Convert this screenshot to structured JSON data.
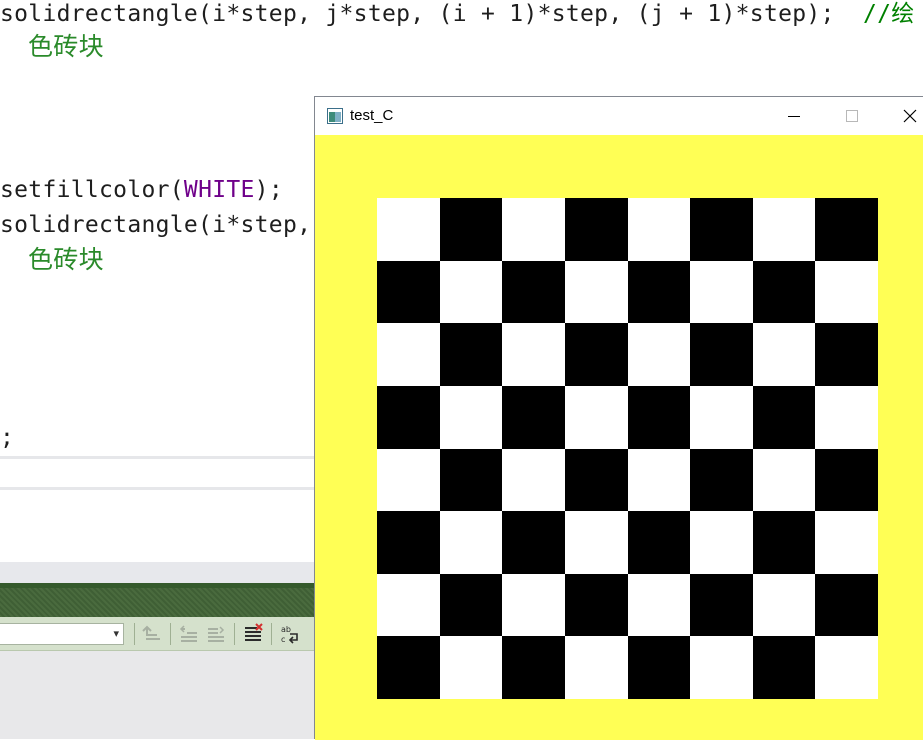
{
  "editor": {
    "line1_code": "solidrectangle(i*step, j*step, (i + 1)*step, (j + 1)*step);",
    "line1_comment": "//绘",
    "line1_cont": "色砖块",
    "line2_func": "setfillcolor(",
    "line2_macro": "WHITE",
    "line2_end": ");",
    "line3_code": "solidrectangle(i*step,",
    "line3_cont": "色砖块",
    "line4_code": ";"
  },
  "output_panel": {
    "dropdown_value": "",
    "tools": [
      "goto-previous-icon",
      "find-previous-icon",
      "find-next-icon",
      "clear-all-icon",
      "toggle-word-wrap-icon"
    ]
  },
  "window": {
    "title": "test_C",
    "buttons": [
      "minimize",
      "maximize",
      "close"
    ],
    "background_color": "#ffff55",
    "board": {
      "rows": 8,
      "cols": 8,
      "top_left": "white",
      "colors": [
        "#ffffff",
        "#000000"
      ]
    }
  }
}
